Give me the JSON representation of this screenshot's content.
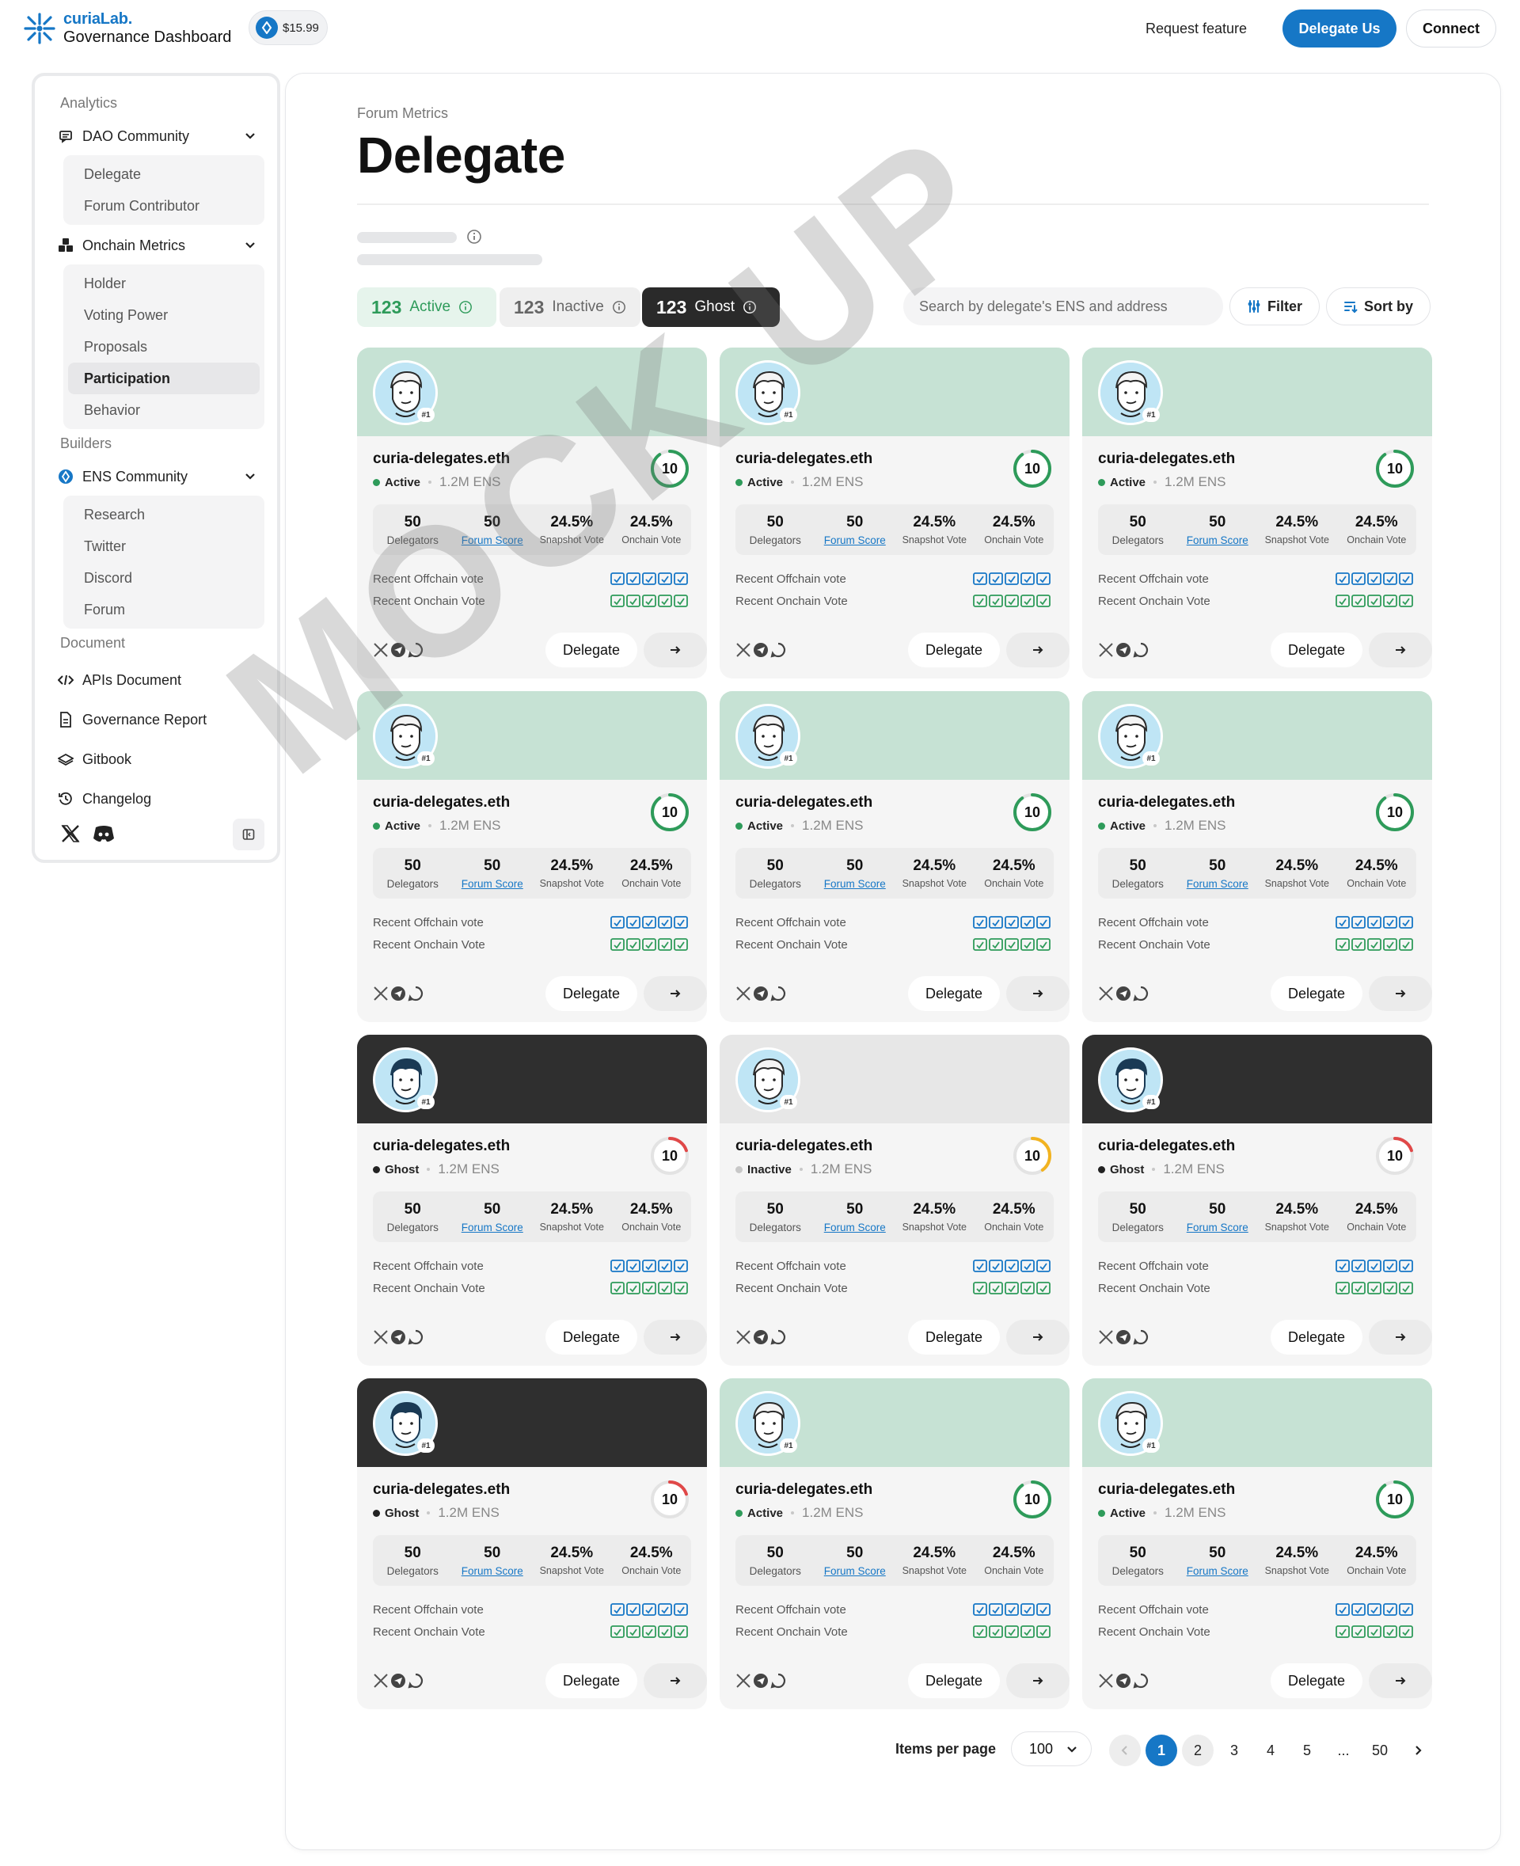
{
  "header": {
    "brand_top": "curiaLab.",
    "brand_bottom": "Governance Dashboard",
    "price": "$15.99",
    "request_feature": "Request feature",
    "delegate_us": "Delegate Us",
    "connect": "Connect",
    "brand_color": "#1677c6"
  },
  "sidebar": {
    "analytics_label": "Analytics",
    "dao_community": "DAO Community",
    "dao_items": [
      "Delegate",
      "Forum Contributor"
    ],
    "onchain_metrics": "Onchain Metrics",
    "onchain_items": [
      "Holder",
      "Voting Power",
      "Proposals",
      "Participation",
      "Behavior"
    ],
    "builders_label": "Builders",
    "ens_community": "ENS Community",
    "ens_items": [
      "Research",
      "Twitter",
      "Discord",
      "Forum"
    ],
    "document_label": "Document",
    "apis_document": "APIs Document",
    "governance_report": "Governance Report",
    "gitbook": "Gitbook",
    "changelog": "Changelog"
  },
  "main": {
    "breadcrumb": "Forum Metrics",
    "title": "Delegate",
    "tabs": [
      {
        "count": "123",
        "label": "Active"
      },
      {
        "count": "123",
        "label": "Inactive"
      },
      {
        "count": "123",
        "label": "Ghost"
      }
    ],
    "search_placeholder": "Search by delegate's ENS and address",
    "filter_label": "Filter",
    "sort_label": "Sort by"
  },
  "card_labels": {
    "delegators": "Delegators",
    "forum_score": "Forum Score",
    "snapshot_vote": "Snapshot Vote",
    "onchain_vote": "Onchain Vote",
    "recent_offchain": "Recent Offchain vote",
    "recent_onchain": "Recent Onchain Vote",
    "delegate_btn": "Delegate"
  },
  "cards": [
    {
      "name": "curia-delegates.eth",
      "status": "Active",
      "ens": "1.2M ENS",
      "score": "10",
      "rank": "#1",
      "delegators": "50",
      "forum_score": "50",
      "snapshot": "24.5%",
      "onchain": "24.5%",
      "theme": "green",
      "score_fraction": 0.9,
      "score_color": "#2e9b5a"
    },
    {
      "name": "curia-delegates.eth",
      "status": "Active",
      "ens": "1.2M ENS",
      "score": "10",
      "rank": "#1",
      "delegators": "50",
      "forum_score": "50",
      "snapshot": "24.5%",
      "onchain": "24.5%",
      "theme": "green",
      "score_fraction": 0.9,
      "score_color": "#2e9b5a"
    },
    {
      "name": "curia-delegates.eth",
      "status": "Active",
      "ens": "1.2M ENS",
      "score": "10",
      "rank": "#1",
      "delegators": "50",
      "forum_score": "50",
      "snapshot": "24.5%",
      "onchain": "24.5%",
      "theme": "green",
      "score_fraction": 0.9,
      "score_color": "#2e9b5a"
    },
    {
      "name": "curia-delegates.eth",
      "status": "Active",
      "ens": "1.2M ENS",
      "score": "10",
      "rank": "#1",
      "delegators": "50",
      "forum_score": "50",
      "snapshot": "24.5%",
      "onchain": "24.5%",
      "theme": "green",
      "score_fraction": 0.9,
      "score_color": "#2e9b5a"
    },
    {
      "name": "curia-delegates.eth",
      "status": "Active",
      "ens": "1.2M ENS",
      "score": "10",
      "rank": "#1",
      "delegators": "50",
      "forum_score": "50",
      "snapshot": "24.5%",
      "onchain": "24.5%",
      "theme": "green",
      "score_fraction": 0.9,
      "score_color": "#2e9b5a"
    },
    {
      "name": "curia-delegates.eth",
      "status": "Active",
      "ens": "1.2M ENS",
      "score": "10",
      "rank": "#1",
      "delegators": "50",
      "forum_score": "50",
      "snapshot": "24.5%",
      "onchain": "24.5%",
      "theme": "green",
      "score_fraction": 0.9,
      "score_color": "#2e9b5a"
    },
    {
      "name": "curia-delegates.eth",
      "status": "Ghost",
      "ens": "1.2M ENS",
      "score": "10",
      "rank": "#1",
      "delegators": "50",
      "forum_score": "50",
      "snapshot": "24.5%",
      "onchain": "24.5%",
      "theme": "dark",
      "score_fraction": 0.2,
      "score_color": "#e04848"
    },
    {
      "name": "curia-delegates.eth",
      "status": "Inactive",
      "ens": "1.2M ENS",
      "score": "10",
      "rank": "#1",
      "delegators": "50",
      "forum_score": "50",
      "snapshot": "24.5%",
      "onchain": "24.5%",
      "theme": "gray",
      "score_fraction": 0.4,
      "score_color": "#f2b320"
    },
    {
      "name": "curia-delegates.eth",
      "status": "Ghost",
      "ens": "1.2M ENS",
      "score": "10",
      "rank": "#1",
      "delegators": "50",
      "forum_score": "50",
      "snapshot": "24.5%",
      "onchain": "24.5%",
      "theme": "dark",
      "score_fraction": 0.2,
      "score_color": "#e04848"
    },
    {
      "name": "curia-delegates.eth",
      "status": "Ghost",
      "ens": "1.2M ENS",
      "score": "10",
      "rank": "#1",
      "delegators": "50",
      "forum_score": "50",
      "snapshot": "24.5%",
      "onchain": "24.5%",
      "theme": "dark",
      "score_fraction": 0.2,
      "score_color": "#e04848"
    },
    {
      "name": "curia-delegates.eth",
      "status": "Active",
      "ens": "1.2M ENS",
      "score": "10",
      "rank": "#1",
      "delegators": "50",
      "forum_score": "50",
      "snapshot": "24.5%",
      "onchain": "24.5%",
      "theme": "green",
      "score_fraction": 0.9,
      "score_color": "#2e9b5a"
    },
    {
      "name": "curia-delegates.eth",
      "status": "Active",
      "ens": "1.2M ENS",
      "score": "10",
      "rank": "#1",
      "delegators": "50",
      "forum_score": "50",
      "snapshot": "24.5%",
      "onchain": "24.5%",
      "theme": "green",
      "score_fraction": 0.9,
      "score_color": "#2e9b5a"
    }
  ],
  "pagination": {
    "items_per_page_label": "Items per page",
    "items_per_page": "100",
    "pages": [
      "1",
      "2",
      "3",
      "4",
      "5",
      "...",
      "50"
    ]
  },
  "watermark": "MOCK UP",
  "status_colors": {
    "Active": "#2e9b5a",
    "Inactive": "#c8c8c8",
    "Ghost": "#222222"
  }
}
